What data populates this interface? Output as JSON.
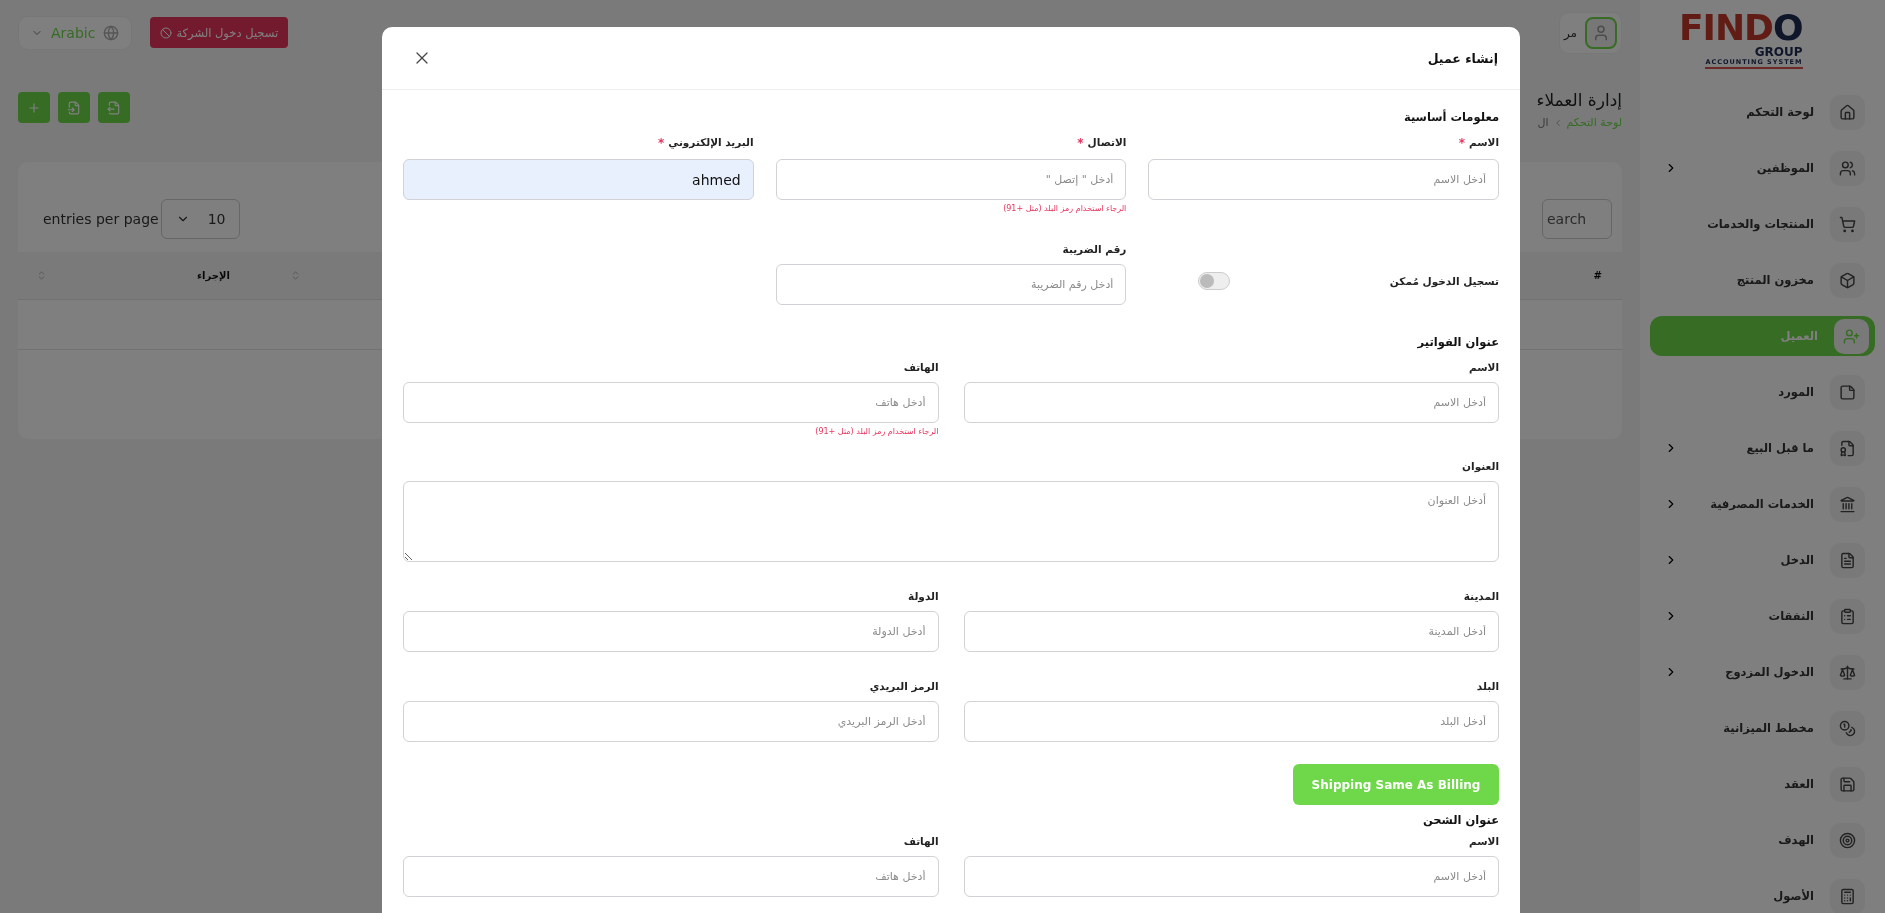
{
  "topbar": {
    "language": "Arabic",
    "company_login_button": "تسجيل دخول الشركة",
    "user_name": "مر"
  },
  "toolbar_buttons": [
    {
      "kind": "add"
    },
    {
      "kind": "import"
    },
    {
      "kind": "export"
    }
  ],
  "page": {
    "title": "إدارة العملاء",
    "breadcrumb": [
      "لوحة التحكم",
      "ال"
    ]
  },
  "table": {
    "entries_label": "entries per page",
    "page_size": "10",
    "search_placeholder": "earch",
    "columns": [
      "#",
      "الإجراء"
    ]
  },
  "sidebar": {
    "logo": {
      "word_start": "FIND",
      "word_end": "O",
      "group": "GROUP",
      "tagline": "ACCOUNTING SYSTEM"
    },
    "items": [
      {
        "label": "لوحة التحكم",
        "expandable": false,
        "selected": false
      },
      {
        "label": "الموظفين",
        "expandable": true,
        "selected": false
      },
      {
        "label": "المنتجات والخدمات",
        "expandable": false,
        "selected": false
      },
      {
        "label": "مخزون المنتج",
        "expandable": false,
        "selected": false
      },
      {
        "label": "العميل",
        "expandable": false,
        "selected": true
      },
      {
        "label": "المورد",
        "expandable": false,
        "selected": false
      },
      {
        "label": "ما قبل البيع",
        "expandable": true,
        "selected": false
      },
      {
        "label": "الخدمات المصرفية",
        "expandable": true,
        "selected": false
      },
      {
        "label": "الدخل",
        "expandable": true,
        "selected": false
      },
      {
        "label": "النفقات",
        "expandable": true,
        "selected": false
      },
      {
        "label": "الدخول المزدوج",
        "expandable": true,
        "selected": false
      },
      {
        "label": "مخطط الميزانية",
        "expandable": false,
        "selected": false
      },
      {
        "label": "العقد",
        "expandable": false,
        "selected": false
      },
      {
        "label": "الهدف",
        "expandable": false,
        "selected": false
      },
      {
        "label": "الأصول",
        "expandable": false,
        "selected": false
      }
    ]
  },
  "modal": {
    "title": "إنشاء عميل",
    "sections": [
      {
        "title": "معلومات أساسية",
        "rows": [
          {
            "fields": [
              {
                "kind": "input",
                "label": "الاسم",
                "required_mark": "*",
                "placeholder": "أدخل الاسم"
              },
              {
                "kind": "input",
                "label": "الاتصال",
                "required_mark": "*",
                "placeholder": "أدخل \" إتصل \"",
                "hint": "الرجاء استخدام رمز البلد (مثل +91)"
              },
              {
                "kind": "input",
                "label": "البريد الإلكتروني",
                "required_mark": "*",
                "value": "ahmed",
                "autofilled": true
              }
            ]
          },
          {
            "fields": [
              {
                "kind": "toggle",
                "label": "تسجيل الدخول مُمكن",
                "on": false
              },
              {
                "kind": "input",
                "label": "رقم الضريبة",
                "placeholder": "أدخل رقم الضريبة"
              }
            ]
          }
        ]
      },
      {
        "title": "عنوان الفواتير",
        "rows": [
          {
            "fields": [
              {
                "kind": "input",
                "label": "الاسم",
                "placeholder": "أدخل الاسم"
              },
              {
                "kind": "input",
                "label": "الهاتف",
                "placeholder": "أدخل هاتف",
                "hint": "الرجاء استخدام رمز البلد (مثل +91)"
              }
            ]
          },
          {
            "fields": [
              {
                "kind": "textarea",
                "label": "العنوان",
                "placeholder": "أدخل العنوان"
              }
            ]
          },
          {
            "fields": [
              {
                "kind": "input",
                "label": "المدينة",
                "placeholder": "أدخل المدينة"
              },
              {
                "kind": "input",
                "label": "الدولة",
                "placeholder": "أدخل الدولة"
              }
            ]
          },
          {
            "fields": [
              {
                "kind": "input",
                "label": "البلد",
                "placeholder": "أدخل البلد"
              },
              {
                "kind": "input",
                "label": "الرمز البريدي",
                "placeholder": "أدخل الرمز البريدي"
              }
            ]
          }
        ],
        "button": "Shipping Same As Billing"
      },
      {
        "title": "عنوان الشحن",
        "rows": [
          {
            "fields": [
              {
                "kind": "input",
                "label": "الاسم",
                "placeholder": "أدخل الاسم"
              },
              {
                "kind": "input",
                "label": "الهاتف",
                "placeholder": "أدخل هاتف"
              }
            ]
          }
        ]
      }
    ]
  }
}
